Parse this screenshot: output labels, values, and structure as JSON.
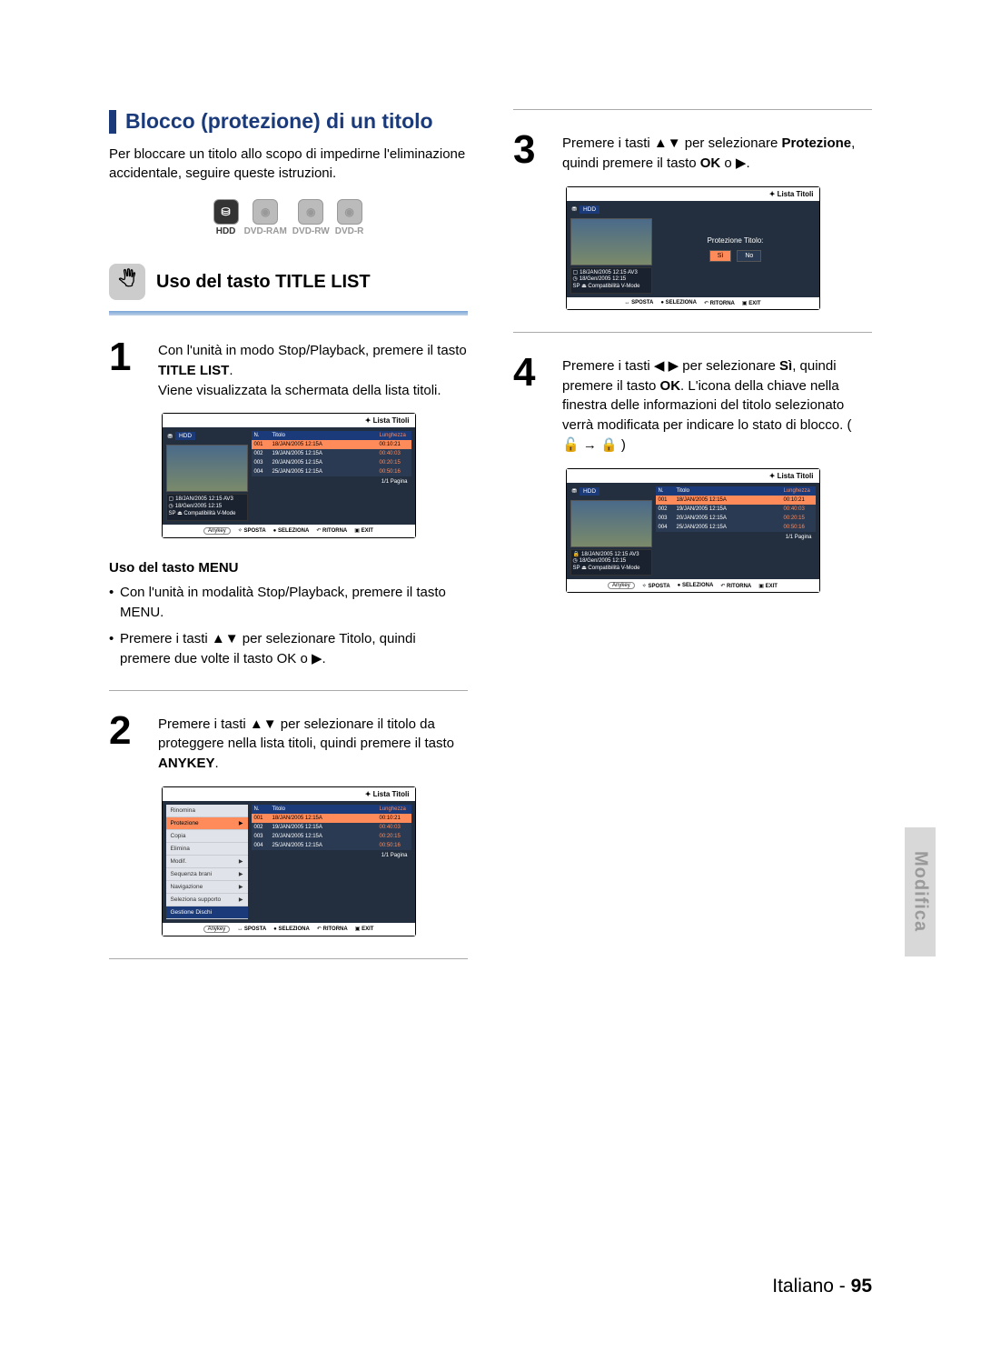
{
  "section_title": "Blocco (protezione) di un titolo",
  "intro": "Per bloccare un titolo allo scopo di impedirne l'eliminazione accidentale, seguire queste istruzioni.",
  "media": [
    "HDD",
    "DVD-RAM",
    "DVD-RW",
    "DVD-R"
  ],
  "sub_heading": "Uso del tasto TITLE LIST",
  "step1": {
    "line1": "Con l'unità in modo Stop/Playback, premere il tasto ",
    "bold1": "TITLE LIST",
    "line2": "Viene visualizzata la schermata della lista titoli."
  },
  "step2": {
    "line1": "Premere i tasti ▲▼ per selezionare il titolo da proteggere nella lista titoli, quindi premere il tasto ",
    "bold1": "ANYKEY"
  },
  "step3": {
    "line1a": "Premere i tasti ▲▼ per selezionare ",
    "bold1": "Protezione",
    "line1b": ", quindi premere il tasto ",
    "bold2": "OK",
    "line1c": " o ▶."
  },
  "step4": {
    "line1a": "Premere i tasti ◀ ▶ per selezionare ",
    "bold1": "Sì",
    "line1b": ", quindi premere il tasto ",
    "bold2": "OK",
    "line1c": ". L'icona della chiave nella finestra delle informazioni del titolo selezionato verrà modificata per indicare lo stato di blocco. ( 🔓 → 🔒 )"
  },
  "menu_note": {
    "heading": "Uso del tasto MENU",
    "b1a": "Con l'unità in modalità Stop/Playback, premere il tasto ",
    "b1b": "MENU",
    "b2a": "Premere i tasti ▲▼ per selezionare ",
    "b2b": "Titolo",
    "b2c": ", quindi premere due volte il tasto ",
    "b2d": "OK",
    "b2e": " o ▶."
  },
  "osd": {
    "title": "Lista Titoli",
    "drive": "HDD",
    "info": {
      "name": "18/JAN/2005 12:15 AV3",
      "time": "18/Gen/2005 12:15",
      "mode": "SP ⏏ Compatibilità V-Mode"
    },
    "cols": {
      "n": "N.",
      "t": "Titolo",
      "l": "Lunghezza"
    },
    "rows": [
      {
        "n": "001",
        "t": "18/JAN/2005 12:15A",
        "l": "00:10:21"
      },
      {
        "n": "002",
        "t": "19/JAN/2005 12:15A",
        "l": "00:40:03"
      },
      {
        "n": "003",
        "t": "20/JAN/2005 12:15A",
        "l": "00:20:15"
      },
      {
        "n": "004",
        "t": "25/JAN/2005 12:15A",
        "l": "00:50:16"
      }
    ],
    "pagina": "1/1 Pagina",
    "foot": {
      "anykey": "Anykey",
      "sposta": "SPOSTA",
      "seleziona": "SELEZIONA",
      "ritorna": "RITORNA",
      "exit": "EXIT"
    },
    "menu_items": [
      "Rinomina",
      "Protezione",
      "Copia",
      "Elimina",
      "Modif.",
      "Sequenza brani",
      "Navigazione",
      "Seleziona supporto",
      "Gestione Dischi"
    ],
    "dialog": {
      "label": "Protezione Titolo:",
      "yes": "Sì",
      "no": "No"
    }
  },
  "side_tab": "Modifica",
  "footer": {
    "lang": "Italiano",
    "sep": " - ",
    "page": "95"
  }
}
